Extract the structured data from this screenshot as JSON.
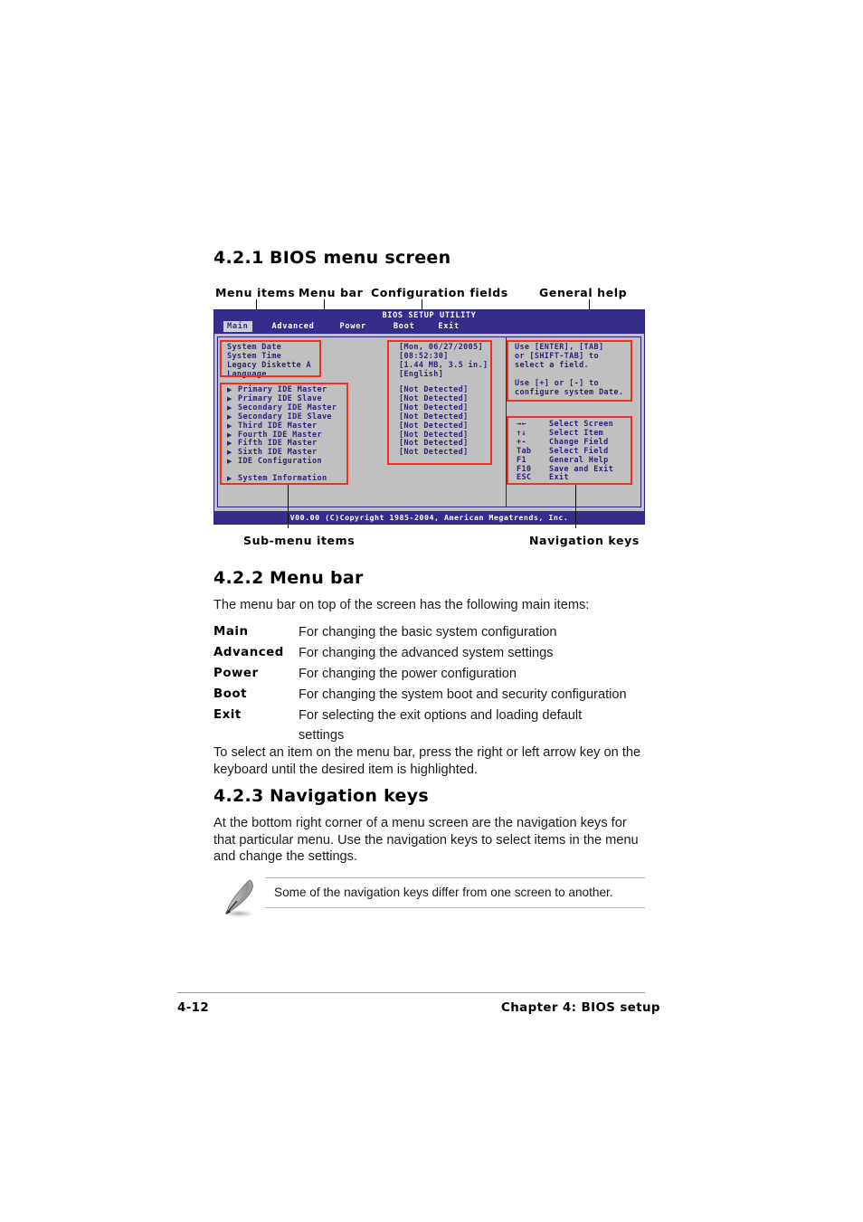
{
  "sections": {
    "s421": {
      "num": "4.2.1",
      "title": "BIOS menu screen"
    },
    "s422": {
      "num": "4.2.2",
      "title": "Menu bar"
    },
    "s423": {
      "num": "4.2.3",
      "title": "Navigation keys"
    }
  },
  "callouts": {
    "menu_items": "Menu items",
    "menu_bar": "Menu bar",
    "configuration_fields": "Configuration fields",
    "general_help": "General help",
    "submenu_items": "Sub-menu items",
    "navigation_keys": "Navigation keys"
  },
  "bios": {
    "title": "BIOS SETUP UTILITY",
    "tabs": [
      {
        "label": "Main",
        "active": true
      },
      {
        "label": "Advanced",
        "active": false
      },
      {
        "label": "Power",
        "active": false
      },
      {
        "label": "Boot",
        "active": false
      },
      {
        "label": "Exit",
        "active": false
      }
    ],
    "menu_items": [
      "System Date",
      "System Time",
      "Legacy Diskette A",
      "Language"
    ],
    "submenu_items": [
      "Primary IDE Master",
      "Primary IDE Slave",
      "Secondary IDE Master",
      "Secondary IDE Slave",
      "Third IDE Master",
      "Fourth IDE Master",
      "Fifth IDE Master",
      "Sixth IDE Master",
      "IDE Configuration"
    ],
    "submenu_items_extra": [
      "System Information"
    ],
    "config_values_top": [
      "[Mon, 06/27/2005]",
      "[08:52:30]",
      "[1.44 MB, 3.5 in.]",
      "[English]"
    ],
    "config_values_ide": [
      "[Not Detected]",
      "[Not Detected]",
      "[Not Detected]",
      "[Not Detected]",
      "[Not Detected]",
      "[Not Detected]",
      "[Not Detected]",
      "[Not Detected]"
    ],
    "general_help": [
      "Use [ENTER], [TAB]",
      "or [SHIFT-TAB] to",
      "select a field.",
      "",
      "Use [+] or [-] to",
      "configure system Date."
    ],
    "nav_keys": [
      {
        "key": "→←",
        "desc": "Select Screen"
      },
      {
        "key": "↑↓",
        "desc": "Select Item"
      },
      {
        "key": "+-",
        "desc": "Change Field"
      },
      {
        "key": "Tab",
        "desc": "Select Field"
      },
      {
        "key": "F1",
        "desc": "General Help"
      },
      {
        "key": "F10",
        "desc": "Save and Exit"
      },
      {
        "key": "ESC",
        "desc": "Exit"
      }
    ],
    "copyright": "V00.00  (C)Copyright 1985-2004, American Megatrends, Inc.",
    "colors": {
      "chrome": "#362c8c",
      "text": "#2d2478",
      "background": "#c0c0c0",
      "active_tab_bg": "#cfcfcf",
      "annotation": "#ee3124"
    }
  },
  "menu_bar_section": {
    "intro": "The menu bar on top of the screen has the following main items:",
    "entries": [
      {
        "term": "Main",
        "desc": "For changing the basic system configuration"
      },
      {
        "term": "Advanced",
        "desc": "For changing the advanced system settings"
      },
      {
        "term": "Power",
        "desc": "For changing the power configuration"
      },
      {
        "term": "Boot",
        "desc": "For changing the system boot and security configuration"
      },
      {
        "term": "Exit",
        "desc": "For selecting the exit options and loading default settings"
      }
    ],
    "outro": "To select an item on the menu bar, press the right or left arrow key on the keyboard until the desired item is highlighted."
  },
  "nav_keys_section": {
    "body": "At the bottom right corner of a menu screen are the navigation keys for that particular menu. Use the navigation keys to select items in the menu and change the settings."
  },
  "note": {
    "text": "Some of the navigation keys differ from one screen to another."
  },
  "footer": {
    "page": "4-12",
    "chapter": "Chapter 4: BIOS setup"
  }
}
